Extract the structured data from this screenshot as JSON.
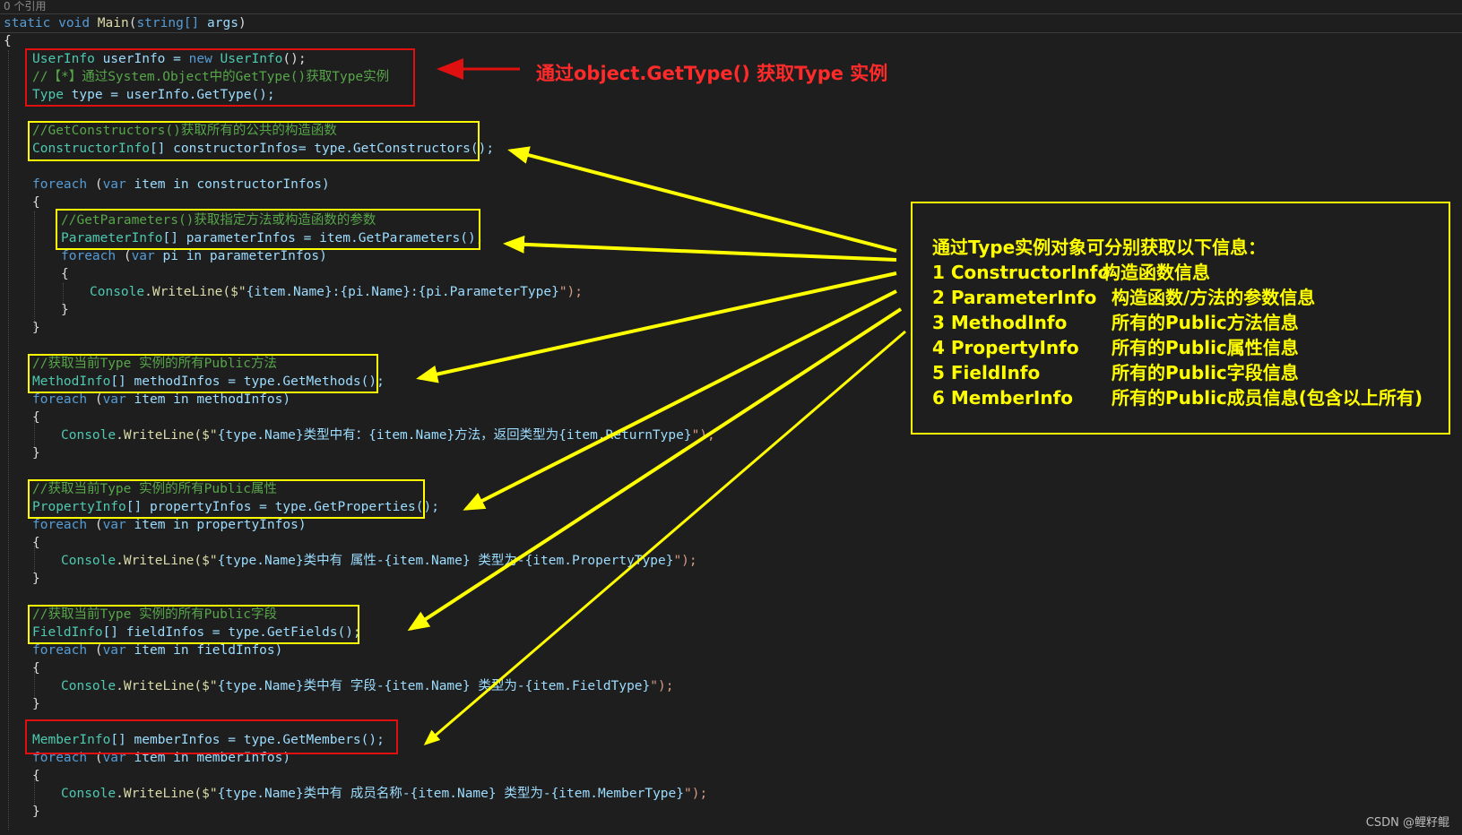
{
  "editor": {
    "codelens": "0 个引用",
    "signature": {
      "kw1": "static",
      "kw2": "void",
      "name": "Main",
      "param_type": "string[]",
      "param_name": "args",
      "open": "(",
      "close": ")"
    },
    "brace_open": "{",
    "brace_close": "}"
  },
  "code": {
    "l1": {
      "type": "UserInfo",
      "rest1": " userInfo = ",
      "kw": "new",
      "type2": "UserInfo",
      "rest2": "();"
    },
    "l2": {
      "comment": "//【*】通过System.Object中的GetType()获取Type实例"
    },
    "l3": {
      "type": "Type",
      "rest": " type = userInfo.GetType();"
    },
    "l4": {
      "comment": "//GetConstructors()获取所有的公共的构造函数"
    },
    "l5": {
      "type": "ConstructorInfo",
      "rest": "[] constructorInfos= type.GetConstructors();"
    },
    "l6": {
      "kw": "foreach",
      "p1": " (",
      "kw2": "var",
      "rest": " item in constructorInfos)"
    },
    "l7": {
      "text": "{"
    },
    "l8": {
      "comment": "//GetParameters()获取指定方法或构造函数的参数"
    },
    "l9": {
      "type": "ParameterInfo",
      "rest": "[] parameterInfos = item.GetParameters();"
    },
    "l10": {
      "kw": "foreach",
      "p1": " (",
      "kw2": "var",
      "rest": " pi in parameterInfos)"
    },
    "l11": {
      "text": "{"
    },
    "l12": {
      "pre": "Console",
      "mid": ".WriteLine($\"",
      "body": "{item.Name}:{pi.Name}:{pi.ParameterType}",
      "end": "\");"
    },
    "l13": {
      "text": "}"
    },
    "l14": {
      "text": "}"
    },
    "l15": {
      "comment": "//获取当前Type 实例的所有Public方法"
    },
    "l16": {
      "type": "MethodInfo",
      "rest": "[] methodInfos = type.GetMethods();"
    },
    "l17": {
      "kw": "foreach",
      "p1": " (",
      "kw2": "var",
      "rest": " item in methodInfos)"
    },
    "l18": {
      "text": "{"
    },
    "l19": {
      "pre": "Console",
      "mid": ".WriteLine($\"",
      "body": "{type.Name}类型中有：{item.Name}方法，返回类型为{item.ReturnType}",
      "end": "\");"
    },
    "l20": {
      "text": "}"
    },
    "l21": {
      "comment": "//获取当前Type 实例的所有Public属性"
    },
    "l22": {
      "type": "PropertyInfo",
      "rest": "[] propertyInfos = type.GetProperties();"
    },
    "l23": {
      "kw": "foreach",
      "p1": " (",
      "kw2": "var",
      "rest": " item in propertyInfos)"
    },
    "l24": {
      "text": "{"
    },
    "l25": {
      "pre": "Console",
      "mid": ".WriteLine($\"",
      "body": "{type.Name}类中有 属性-{item.Name} 类型为-{item.PropertyType}",
      "end": "\");"
    },
    "l26": {
      "text": "}"
    },
    "l27": {
      "comment": "//获取当前Type 实例的所有Public字段"
    },
    "l28": {
      "type": "FieldInfo",
      "rest": "[] fieldInfos = type.GetFields();"
    },
    "l29": {
      "kw": "foreach",
      "p1": " (",
      "kw2": "var",
      "rest": " item in fieldInfos)"
    },
    "l30": {
      "text": "{"
    },
    "l31": {
      "pre": "Console",
      "mid": ".WriteLine($\"",
      "body": "{type.Name}类中有 字段-{item.Name} 类型为-{item.FieldType}",
      "end": "\");"
    },
    "l32": {
      "text": "}"
    },
    "l33": {
      "type": "MemberInfo",
      "rest": "[] memberInfos = type.GetMembers();"
    },
    "l34": {
      "kw": "foreach",
      "p1": " (",
      "kw2": "var",
      "rest": " item in memberInfos)"
    },
    "l35": {
      "text": "{"
    },
    "l36": {
      "pre": "Console",
      "mid": ".WriteLine($\"",
      "body": "{type.Name}类中有 成员名称-{item.Name} 类型为-{item.MemberType}",
      "end": "\");"
    },
    "l37": {
      "text": "}"
    }
  },
  "annotations": {
    "red_callout": "通过object.GetType() 获取Type 实例",
    "info_title": "通过Type实例对象可分别获取以下信息：",
    "info_rows": [
      {
        "name": "1 ConstructorInfo",
        "desc": "构造函数信息"
      },
      {
        "name": "2 ParameterInfo",
        "desc": "构造函数/方法的参数信息"
      },
      {
        "name": "3 MethodInfo",
        "desc": "所有的Public方法信息"
      },
      {
        "name": "4 PropertyInfo",
        "desc": "所有的Public属性信息"
      },
      {
        "name": "5 FieldInfo",
        "desc": "所有的Public字段信息"
      },
      {
        "name": "6 MemberInfo",
        "desc": "所有的Public成员信息(包含以上所有)"
      }
    ],
    "red_color": "#e01010",
    "yellow_color": "#ffff00"
  },
  "watermark": "CSDN @鲤籽鲲"
}
